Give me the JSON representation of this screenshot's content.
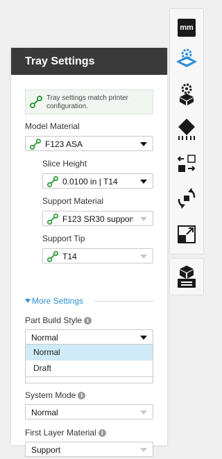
{
  "panel": {
    "title": "Tray Settings",
    "info_message": "Tray settings match printer configuration.",
    "model_material": {
      "label": "Model Material",
      "value": "F123 ASA"
    },
    "slice_height": {
      "label": "Slice Height",
      "value": "0.0100 in | T14"
    },
    "support_material": {
      "label": "Support Material",
      "value": "F123 SR30 support"
    },
    "support_tip": {
      "label": "Support Tip",
      "value": "T14"
    },
    "more_settings": "More Settings",
    "part_build_style": {
      "label": "Part Build Style",
      "value": "Normal",
      "options": [
        "Normal",
        "Draft"
      ]
    },
    "system_mode": {
      "label": "System Mode",
      "value": "Normal"
    },
    "first_layer_material": {
      "label": "First Layer Material",
      "value": "Support"
    }
  },
  "toolbar": {
    "units_badge": "mm",
    "tools": [
      "units-icon",
      "tray-settings-icon",
      "part-settings-icon",
      "orient-icon",
      "arrange-icon",
      "rotate-icon",
      "scale-icon",
      "print-queue-icon"
    ]
  },
  "colors": {
    "accent_blue": "#2e8fd6",
    "confirm_green": "#2e9e3a",
    "header": "#3a3a3a",
    "selected_option": "#cfeaf8"
  }
}
